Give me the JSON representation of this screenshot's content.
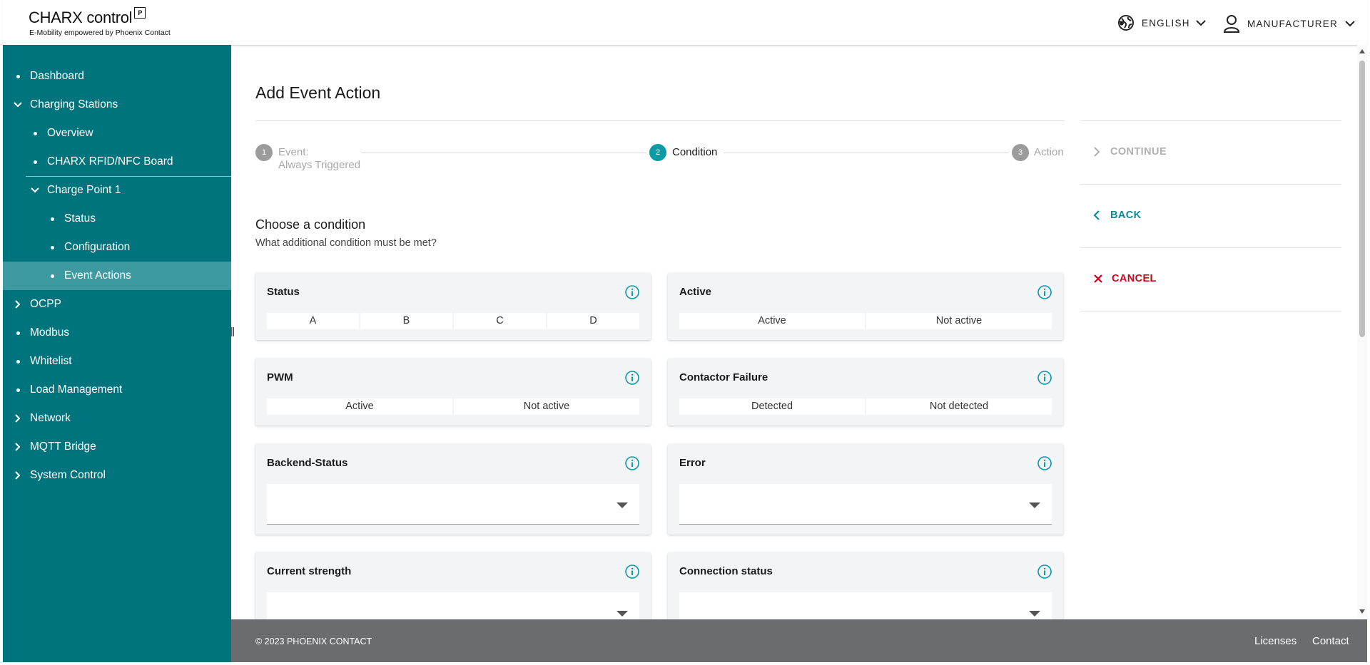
{
  "header": {
    "logo_title": "CHARX control",
    "logo_mark": "P",
    "logo_subtitle": "E-Mobility empowered by Phoenix Contact",
    "language_label": "ENGLISH",
    "user_label": "MANUFACTURER"
  },
  "sidebar": {
    "items": [
      {
        "label": "Dashboard"
      },
      {
        "label": "Charging Stations"
      },
      {
        "label": "Overview"
      },
      {
        "label": "CHARX RFID/NFC Board"
      },
      {
        "label": "Charge Point 1"
      },
      {
        "label": "Status"
      },
      {
        "label": "Configuration"
      },
      {
        "label": "Event Actions"
      },
      {
        "label": "OCPP"
      },
      {
        "label": "Modbus"
      },
      {
        "label": "Whitelist"
      },
      {
        "label": "Load Management"
      },
      {
        "label": "Network"
      },
      {
        "label": "MQTT Bridge"
      },
      {
        "label": "System Control"
      }
    ],
    "collapse_handle": "||"
  },
  "main": {
    "title": "Add Event Action",
    "stepper": [
      {
        "number": "1",
        "label_line1": "Event:",
        "label_line2": "Always Triggered"
      },
      {
        "number": "2",
        "label": "Condition"
      },
      {
        "number": "3",
        "label": "Action"
      }
    ],
    "actions": {
      "continue": "CONTINUE",
      "back": "BACK",
      "cancel": "CANCEL"
    },
    "section_title": "Choose a condition",
    "section_subtitle": "What additional condition must be met?",
    "cards": {
      "status": {
        "title": "Status",
        "options": [
          "A",
          "B",
          "C",
          "D"
        ]
      },
      "active": {
        "title": "Active",
        "options": [
          "Active",
          "Not active"
        ]
      },
      "pwm": {
        "title": "PWM",
        "options": [
          "Active",
          "Not active"
        ]
      },
      "contactor": {
        "title": "Contactor Failure",
        "options": [
          "Detected",
          "Not detected"
        ]
      },
      "backend": {
        "title": "Backend-Status"
      },
      "error": {
        "title": "Error"
      },
      "current": {
        "title": "Current strength"
      },
      "connection": {
        "title": "Connection status"
      }
    }
  },
  "footer": {
    "copyright": "© 2023 PHOENIX CONTACT",
    "licenses": "Licenses",
    "contact": "Contact"
  },
  "colors": {
    "teal": "#00747c",
    "teal_active": "#3d9aa0",
    "accent": "#0a9ba6",
    "cancel_red": "#d0021b",
    "footer_gray": "#6a6c70"
  }
}
